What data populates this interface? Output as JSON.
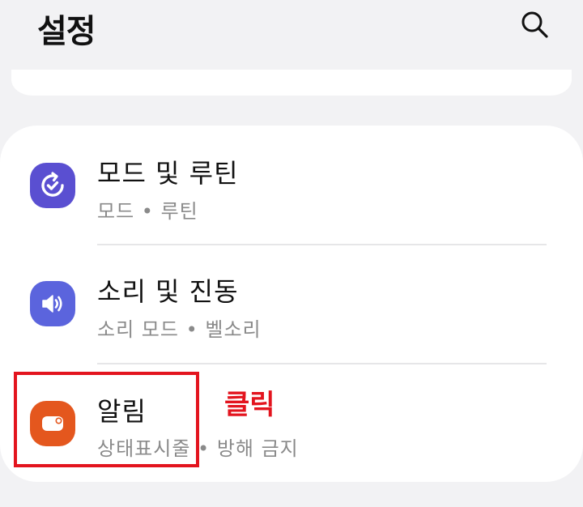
{
  "header": {
    "title": "설정",
    "search_icon": "search-icon"
  },
  "settings": [
    {
      "title": "모드 및 루틴",
      "subtitle": "모드  •  루틴",
      "icon": "modes-routines-icon",
      "icon_color": "#5a4fd1"
    },
    {
      "title": "소리 및 진동",
      "subtitle": "소리 모드  •  벨소리",
      "icon": "speaker-icon",
      "icon_color": "#5b64dd"
    },
    {
      "title": "알림",
      "subtitle": "상태표시줄  •  방해 금지",
      "icon": "notification-icon",
      "icon_color": "#e4571e"
    }
  ],
  "annotation": {
    "label": "클릭",
    "color": "#e3141e"
  }
}
